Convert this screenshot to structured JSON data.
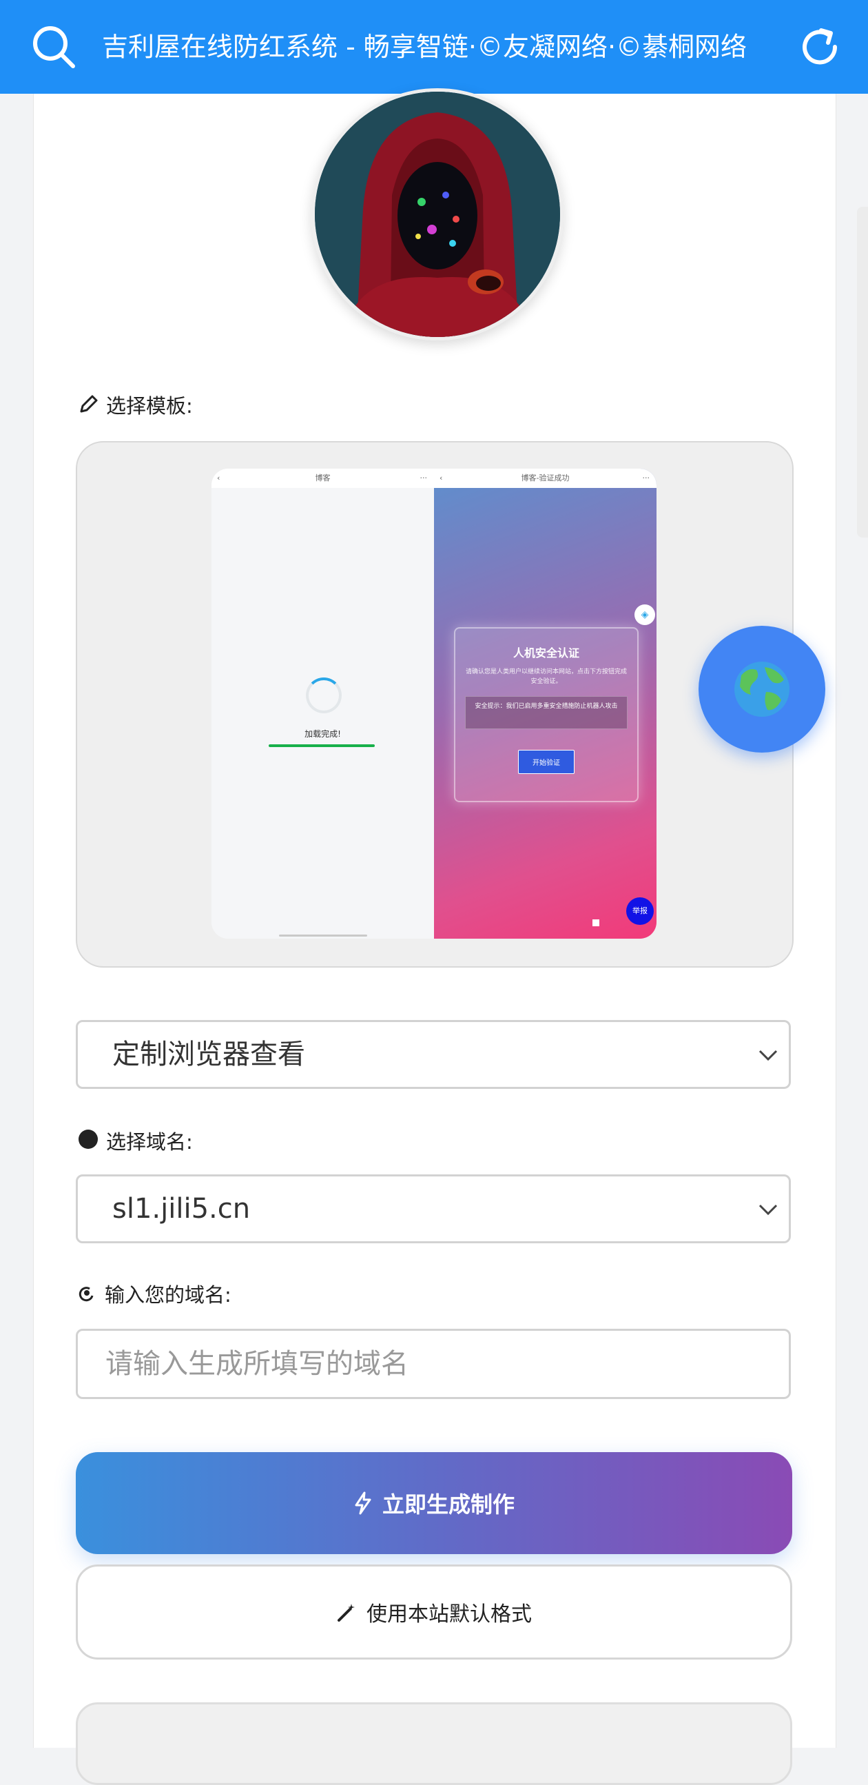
{
  "topbar": {
    "title": "吉利屋在线防红系统 - 畅享智链·©友凝网络·©綦桐网络",
    "search_icon": "search-icon",
    "refresh_icon": "refresh-icon"
  },
  "template_section": {
    "label": "选择模板:",
    "preview": {
      "left_title": "博客",
      "right_title": "博客-验证成功",
      "loading_text": "加载完成!",
      "verify_title": "人机安全认证",
      "verify_desc": "请确认您是人类用户以继续访问本网站，点击下方按钮完成安全验证。",
      "verify_tip": "安全提示：我们已启用多重安全措施防止机器人攻击",
      "verify_button": "开始验证",
      "report_label": "举报"
    }
  },
  "view_mode_select": {
    "value": "定制浏览器查看"
  },
  "domain_section": {
    "label": "选择域名:",
    "value": "sl1.jili5.cn"
  },
  "custom_domain": {
    "label": "输入您的域名:",
    "placeholder": "请输入生成所填写的域名"
  },
  "buttons": {
    "generate": "立即生成制作",
    "default_format": "使用本站默认格式"
  },
  "colors": {
    "topbar": "#1f8ff7",
    "primary_start": "#3a90dd",
    "primary_end": "#8a4bb5",
    "globe": "#4285f4"
  }
}
